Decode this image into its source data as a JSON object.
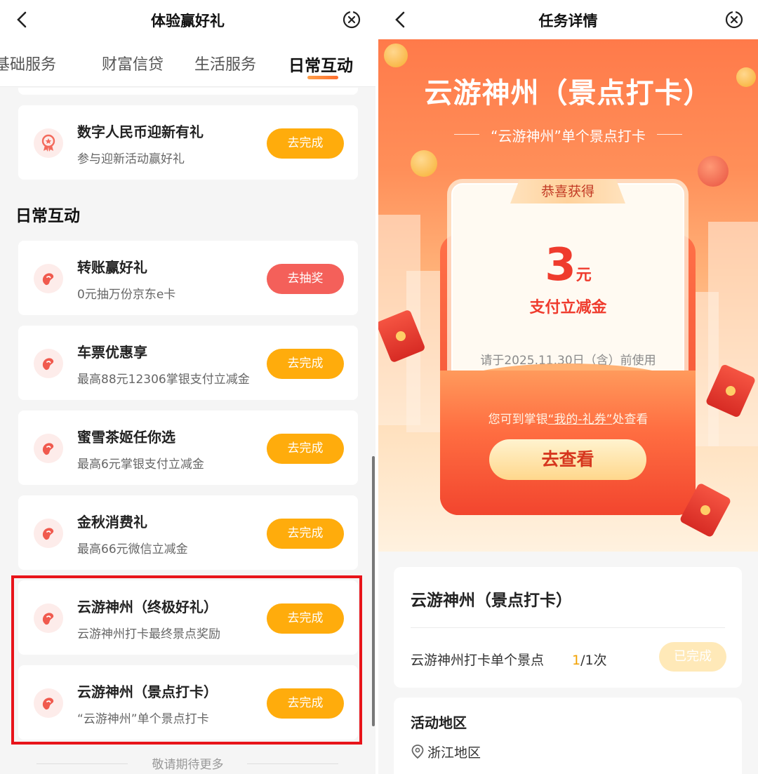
{
  "left": {
    "title": "体验赢好礼",
    "tabs": [
      {
        "label": "基础服务"
      },
      {
        "label": "财富信贷"
      },
      {
        "label": "生活服务"
      },
      {
        "label": "日常互动",
        "active": true
      }
    ],
    "first_card": {
      "title": "数字人民币迎新有礼",
      "subtitle": "参与迎新活动赢好礼",
      "button": "去完成"
    },
    "section_title": "日常互动",
    "tasks": [
      {
        "title": "转账赢好礼",
        "subtitle": "0元抽万份京东e卡",
        "button": "去抽奖",
        "button_color": "#f4605a"
      },
      {
        "title": "车票优惠享",
        "subtitle": "最高88元12306掌银支付立减金",
        "button": "去完成",
        "button_color": "#ffac0c"
      },
      {
        "title": "蜜雪茶姬任你选",
        "subtitle": "最高6元掌银支付立减金",
        "button": "去完成",
        "button_color": "#ffac0c"
      },
      {
        "title": "金秋消费礼",
        "subtitle": "最高66元微信立减金",
        "button": "去完成",
        "button_color": "#ffac0c"
      },
      {
        "title": "云游神州（终极好礼）",
        "subtitle": "云游神州打卡最终景点奖励",
        "button": "去完成",
        "button_color": "#ffac0c"
      },
      {
        "title": "云游神州（景点打卡）",
        "subtitle": "“云游神州”单个景点打卡",
        "button": "去完成",
        "button_color": "#ffac0c"
      }
    ],
    "footer": "敬请期待更多",
    "highlight_color": "#e8141a"
  },
  "right": {
    "title": "任务详情",
    "hero_title": "云游神州（景点打卡）",
    "hero_subtitle": "“云游神州”单个景点打卡",
    "coupon": {
      "tag": "恭喜获得",
      "amount": "3",
      "unit": "元",
      "name": "支付立减金",
      "valid_until": "请于2025.11.30日（含）前使用"
    },
    "tip_prefix": "您可到掌银",
    "tip_link": "“我的-礼券”",
    "tip_suffix": "处查看",
    "view_button": "去查看",
    "task_card": {
      "title": "云游神州（景点打卡）",
      "row_label": "云游神州打卡单个景点",
      "progress_current": "1",
      "progress_rest": "/1次",
      "status_button": "已完成"
    },
    "area_card": {
      "title": "活动地区",
      "value": "浙江地区"
    }
  },
  "icons": {
    "back": "chevron-left-icon",
    "close": "close-circle-icon",
    "task": "bean-icon",
    "location": "location-pin-icon"
  },
  "colors": {
    "accent_orange": "#ffac0c",
    "accent_red": "#f4605a",
    "hero_red": "#ef3b2d"
  }
}
